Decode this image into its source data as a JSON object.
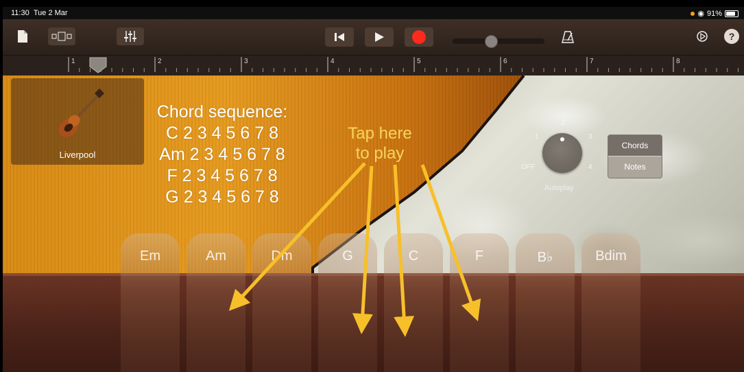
{
  "status": {
    "time": "11:30",
    "date": "Tue 2 Mar",
    "battery": "91%",
    "battery_level": 0.91
  },
  "toolbar": {
    "icons": [
      "document-icon",
      "view-toggle-icon",
      "mixer-icon",
      "rewind-icon",
      "play-icon",
      "record-icon",
      "metronome-icon",
      "settings-icon",
      "help-icon"
    ],
    "volume_level": 0.42,
    "colors": {
      "record": "#ff2a1e",
      "toolbar_bg": "#35291f"
    }
  },
  "ruler": {
    "bars": [
      "1",
      "2",
      "3",
      "4",
      "5",
      "6",
      "7",
      "8"
    ]
  },
  "instrument": {
    "name": "Liverpool"
  },
  "annotation": {
    "sequence_title": "Chord sequence:",
    "sequence_lines": [
      "C 2 3 4 5 6 7 8",
      "Am 2 3 4 5 6 7 8",
      "F 2 3 4 5 6 7 8",
      "G 2 3 4 5 6 7 8"
    ],
    "tap_lines": [
      "Tap here",
      "to play"
    ],
    "arrow_color": "#f7c02a"
  },
  "autoplay": {
    "label": "Autoplay",
    "positions": [
      "OFF",
      "1",
      "2",
      "3",
      "4"
    ],
    "current": "2"
  },
  "mode": {
    "options": [
      "Chords",
      "Notes"
    ],
    "selected": "Chords"
  },
  "chords": [
    "Em",
    "Am",
    "Dm",
    "G",
    "C",
    "F",
    "B♭",
    "Bdim"
  ]
}
